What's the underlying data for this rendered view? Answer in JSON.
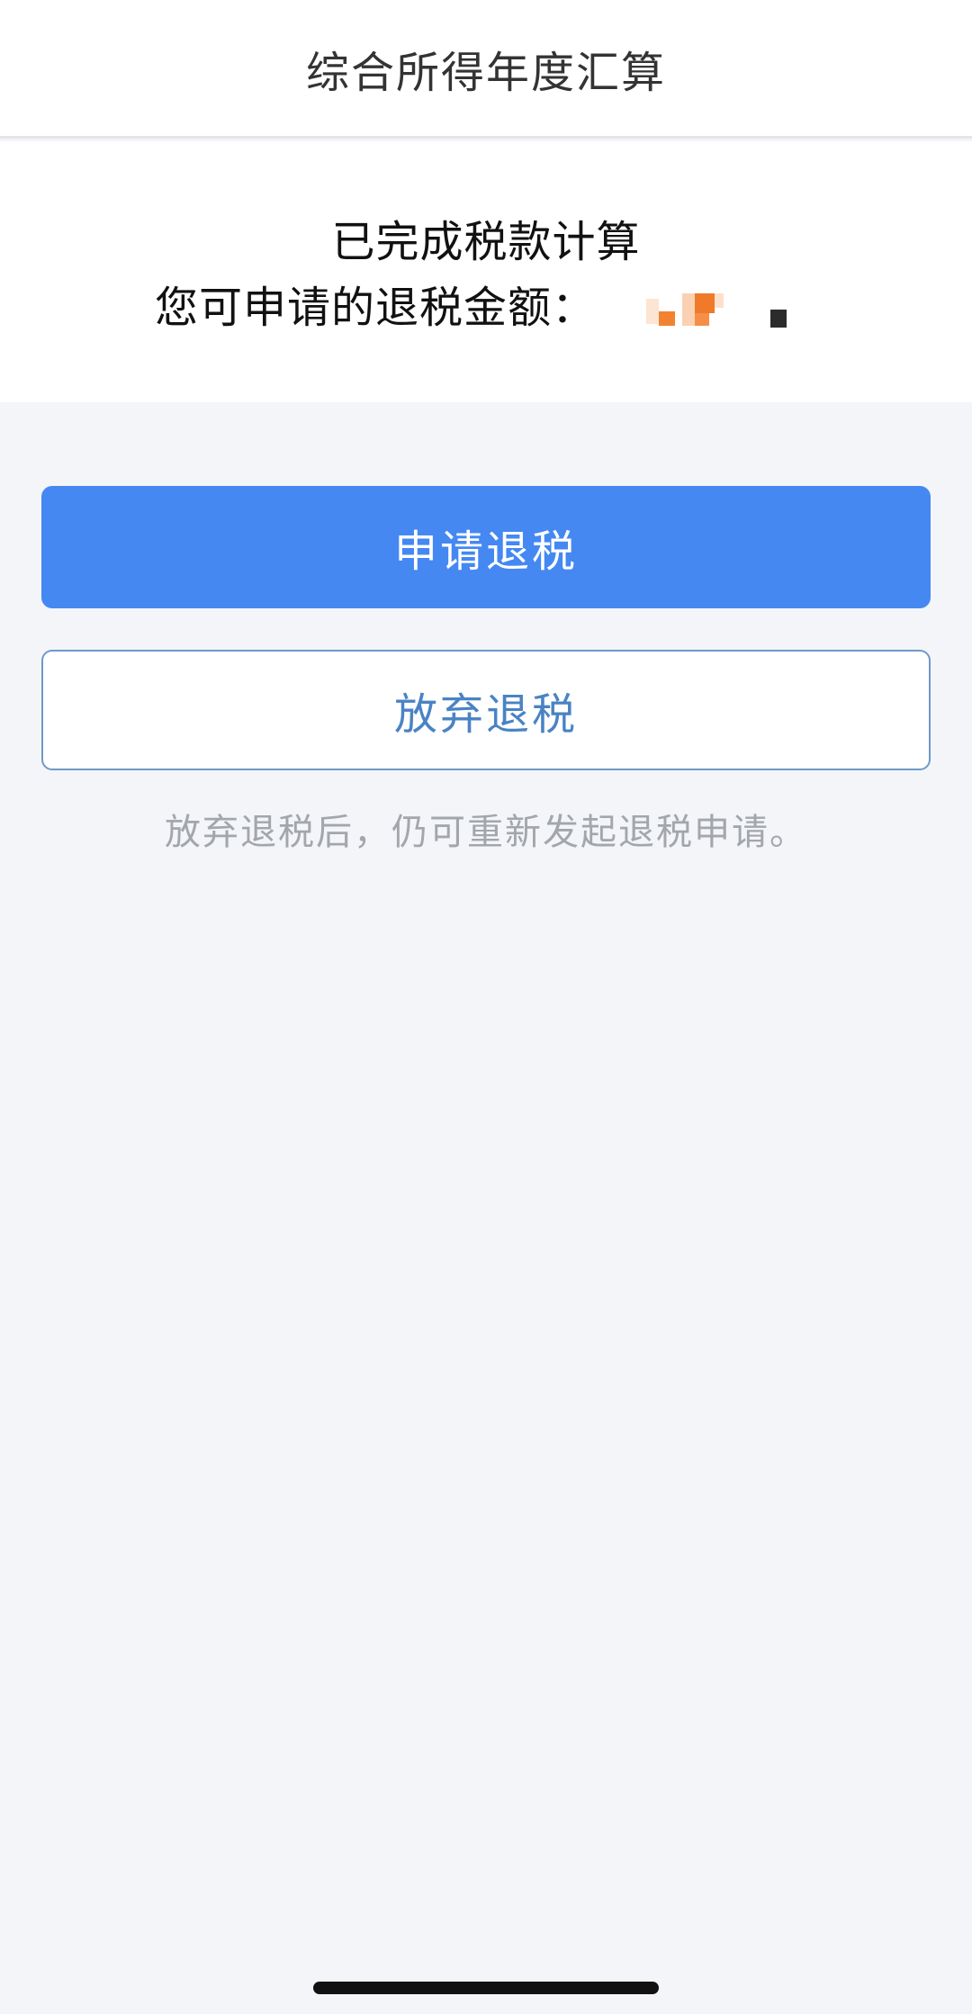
{
  "nav": {
    "title": "综合所得年度汇算"
  },
  "result": {
    "title": "已完成税款计算",
    "amount_label": "您可申请的退税金额："
  },
  "actions": {
    "apply_label": "申请退税",
    "abandon_label": "放弃退税",
    "hint": "放弃退税后，仍可重新发起退税申请。"
  },
  "colors": {
    "primary": "#4588f2",
    "outline": "#6e99c9",
    "amount_accent": "#f07a2a"
  }
}
